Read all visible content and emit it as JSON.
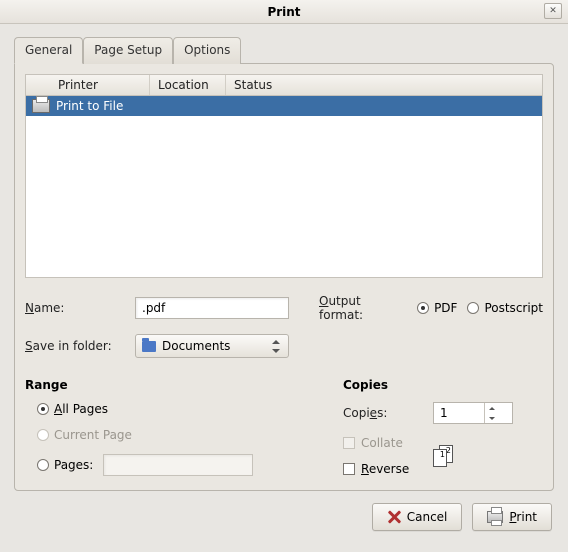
{
  "window": {
    "title": "Print"
  },
  "tabs": {
    "general": "General",
    "page_setup": "Page Setup",
    "options": "Options"
  },
  "list": {
    "headers": {
      "printer": "Printer",
      "location": "Location",
      "status": "Status"
    },
    "rows": [
      {
        "name": "Print to File"
      }
    ]
  },
  "file": {
    "name_label": "Name:",
    "name_underline": "N",
    "name_value": ".pdf",
    "folder_label": "Save in folder:",
    "folder_underline": "S",
    "folder_value": "Documents"
  },
  "output": {
    "label": "Output format:",
    "label_underline": "O",
    "pdf": "PDF",
    "ps": "Postscript",
    "selected": "pdf"
  },
  "range": {
    "title": "Range",
    "all": "All Pages",
    "all_underline": "A",
    "current": "Current Page",
    "pages": "Pages:",
    "pages_value": ""
  },
  "copies": {
    "title": "Copies",
    "copies_label": "Copies:",
    "copies_underline": "e",
    "copies_value": "1",
    "collate": "Collate",
    "reverse": "Reverse",
    "reverse_underline": "R"
  },
  "buttons": {
    "cancel": "Cancel",
    "print": "Print"
  }
}
